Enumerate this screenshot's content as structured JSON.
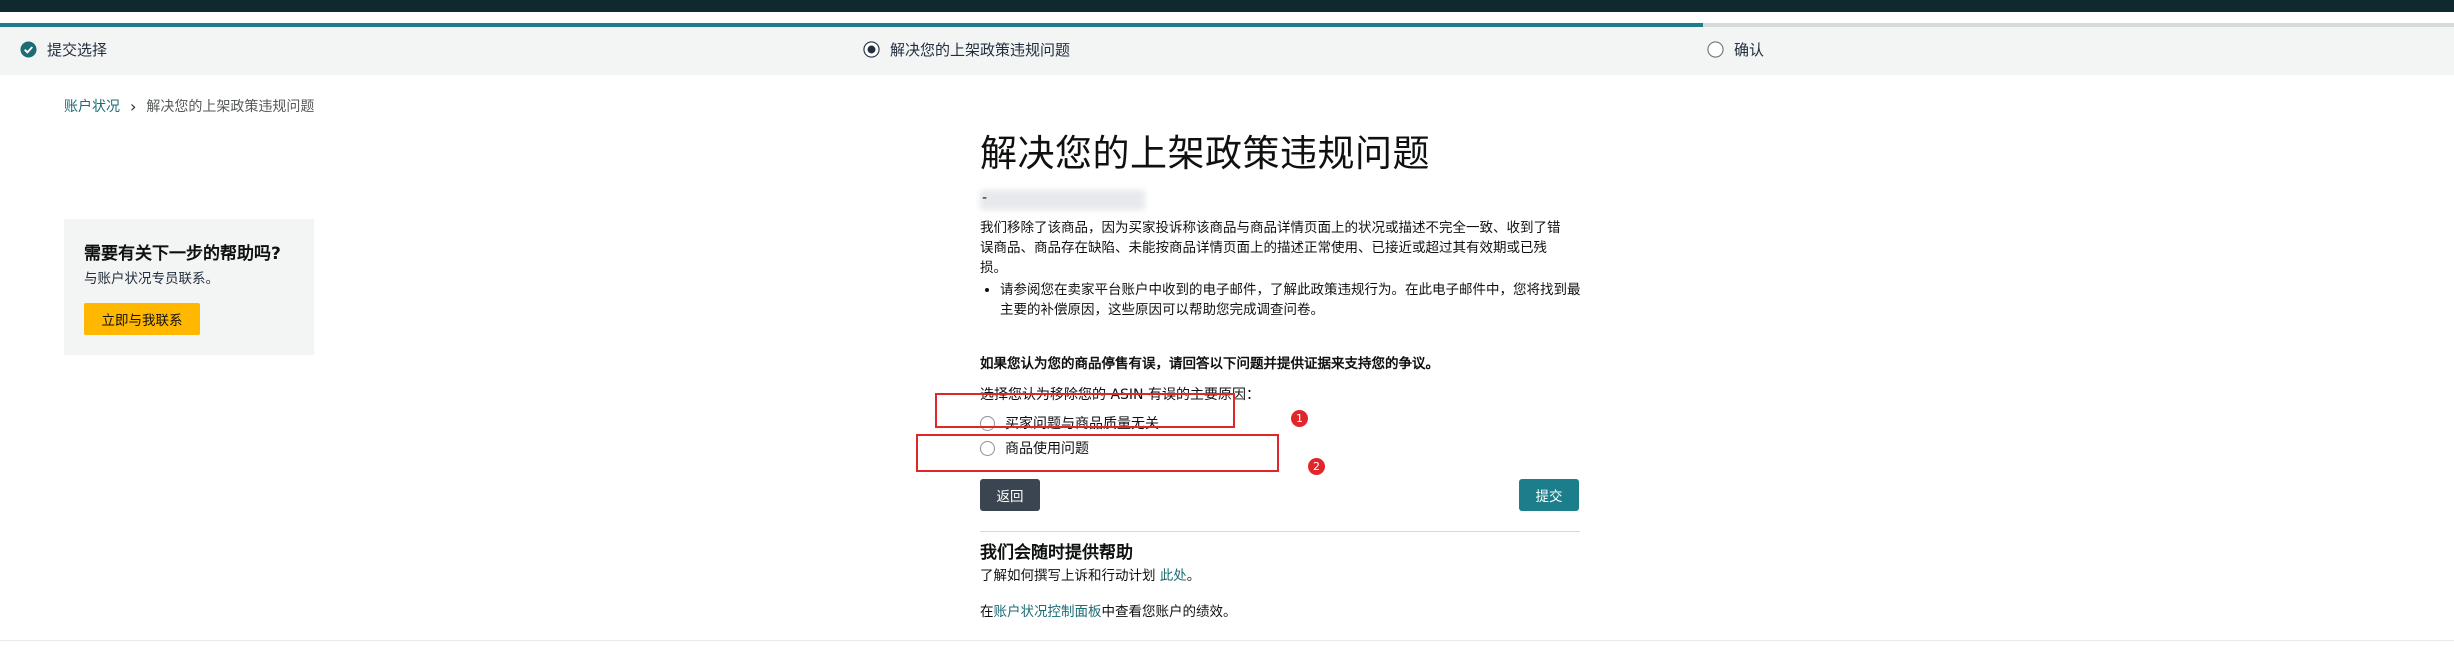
{
  "steps": {
    "progress_fraction": 0.694,
    "items": [
      {
        "label": "提交选择",
        "state": "done"
      },
      {
        "label": "解决您的上架政策违规问题",
        "state": "current"
      },
      {
        "label": "确认",
        "state": "pending"
      }
    ]
  },
  "breadcrumb": {
    "link": "账户状况",
    "separator": "›",
    "current": "解决您的上架政策违规问题"
  },
  "help_card": {
    "title": "需要有关下一步的帮助吗?",
    "text": "与账户状况专员联系。",
    "button": "立即与我联系"
  },
  "main": {
    "title": "解决您的上架政策违规问题",
    "asin_dash": "-",
    "paragraph": "我们移除了该商品，因为买家投诉称该商品与商品详情页面上的状况或描述不完全一致、收到了错误商品、商品存在缺陷、未能按商品详情页面上的描述正常使用、已接近或超过其有效期或已残损。",
    "bullet": "请参阅您在卖家平台账户中收到的电子邮件，了解此政策违规行为。在此电子邮件中，您将找到最主要的补偿原因，这些原因可以帮助您完成调查问卷。",
    "dispute_line": "如果您认为您的商品停售有误，请回答以下问题并提供证据来支持您的争议。",
    "question": "选择您认为移除您的 ASIN 有误的主要原因：",
    "options": [
      "买家问题与商品质量无关",
      "商品使用问题"
    ],
    "annotations": [
      "1",
      "2"
    ],
    "back_button": "返回",
    "submit_button": "提交",
    "help_section": {
      "title": "我们会随时提供帮助",
      "line1_prefix": "了解如何撰写上诉和行动计划 ",
      "line1_link": "此处",
      "line1_suffix": "。",
      "line2_prefix": "在",
      "line2_link": "账户状况控制面板",
      "line2_suffix": "中查看您账户的绩效。"
    }
  },
  "colors": {
    "accent": "#1b7e8a",
    "help_button": "#ffb700",
    "back_button": "#3b4451",
    "annotation": "#e0252b"
  }
}
